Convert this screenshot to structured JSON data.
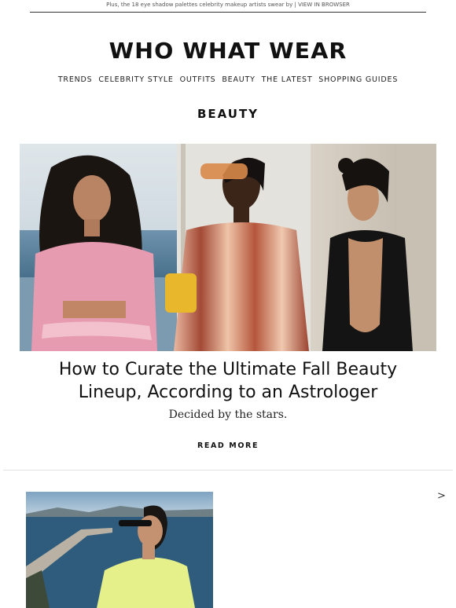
{
  "preheader": {
    "text": "Plus, the 18 eye shadow palettes celebrity makeup artists swear by | ",
    "view_in_browser": "VIEW IN BROWSER"
  },
  "brand": {
    "logo": "WHO WHAT WEAR"
  },
  "nav": {
    "items": [
      "TRENDS",
      "CELEBRITY STYLE",
      "OUTFITS",
      "BEAUTY",
      "THE LATEST",
      "SHOPPING GUIDES"
    ]
  },
  "section": {
    "title": "BEAUTY"
  },
  "feature": {
    "headline": "How to Curate the Ultimate Fall Beauty Lineup, According to an Astrologer",
    "dek": "Decided by the stars.",
    "cta": "READ MORE"
  },
  "next_story": {
    "arrow": ">"
  },
  "colors": {
    "text": "#111111",
    "rule": "#333333",
    "divider": "#e2e2e2"
  }
}
